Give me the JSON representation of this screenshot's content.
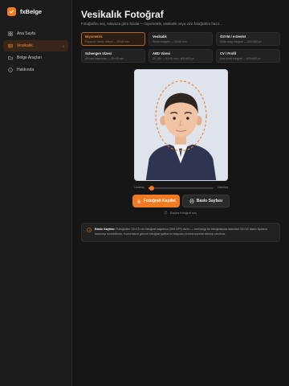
{
  "app": {
    "name": "fxBelge",
    "accent": "#f07b23"
  },
  "sidebar": {
    "items": [
      {
        "label": "Ana Sayfa",
        "icon": "grid-icon",
        "active": false,
        "count": ""
      },
      {
        "label": "Vesikalık",
        "icon": "id-card-icon",
        "active": true,
        "count": "3"
      },
      {
        "label": "Belge Araçları",
        "icon": "folder-icon",
        "active": false,
        "count": ""
      },
      {
        "label": "Hakkında",
        "icon": "info-icon",
        "active": false,
        "count": ""
      }
    ]
  },
  "header": {
    "title": "Vesikalık Fotoğraf",
    "subtitle": "Fotoğrafını seç, kılavuza göre hizala — biyometrik, vesikalık veya vize fotoğrafını hazır..."
  },
  "formats": [
    {
      "title": "Biyometrik",
      "desc": "Pasaport, kimlik, ehliyet — 50×60 mm",
      "active": true
    },
    {
      "title": "Vesikalık",
      "desc": "Resmi belgeler — 45×60 mm",
      "active": false
    },
    {
      "title": "ÖSYM / e-Devlet",
      "desc": "Dijital aday fotoğrafı — 600×800 px",
      "active": false
    },
    {
      "title": "Schengen Vizesi",
      "desc": "AB vize başvurusu — 35×45 mm",
      "active": false
    },
    {
      "title": "ABD Vizesi",
      "desc": "DS-160 — 51×51 mm / 600×600 px",
      "active": false
    },
    {
      "title": "CV / Profil",
      "desc": "Kare profil fotoğrafı — 600×600 px",
      "active": false
    }
  ],
  "zoom": {
    "min_label": "Uzaklaş",
    "max_label": "Yakınlaş",
    "value": 0.05
  },
  "actions": {
    "save_label": "Fotoğrafı Kaydet",
    "print_label": "Baskı Sayfası",
    "reset_label": "Başka fotoğraf seç"
  },
  "info": {
    "title": "Baskı Sayfası:",
    "text": "Fotoğrafın 10×15 cm fotoğraf kağıdına (300 DPI) dizer — herhangi bir fotoğrafçıda standart 10×15 baskı fiyatına basmayı kesebilirsin. Kurumların güncel fotoğraf şartlarını başvuru öncesi kontrol etmeyi unutma."
  }
}
